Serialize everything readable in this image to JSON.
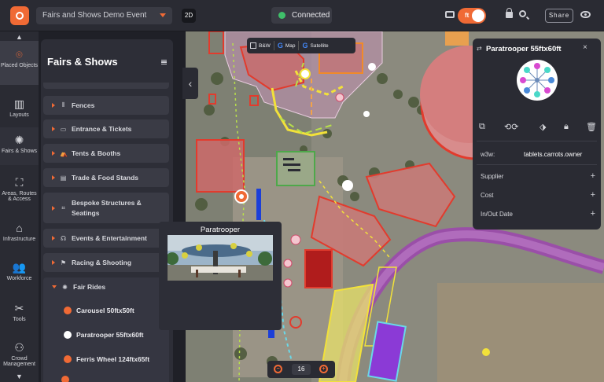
{
  "header": {
    "event_name": "Fairs and Shows Demo Event",
    "view_mode": "2D",
    "status": "Connected",
    "unit": "ft",
    "share_label": "Share"
  },
  "rail": {
    "items": [
      {
        "label": "Placed Objects",
        "icon": "map-pin-icon"
      },
      {
        "label": "Layouts",
        "icon": "columns-icon"
      },
      {
        "label": "Fairs & Shows",
        "icon": "ferris-wheel-icon"
      },
      {
        "label": "Areas, Routes & Access",
        "icon": "area-icon"
      },
      {
        "label": "Infrastructure",
        "icon": "infrastructure-icon"
      },
      {
        "label": "Workforce",
        "icon": "people-icon"
      },
      {
        "label": "Tools",
        "icon": "tools-icon"
      },
      {
        "label": "Crowd Management",
        "icon": "crowd-icon"
      }
    ]
  },
  "panel": {
    "title": "Fairs & Shows",
    "categories": [
      {
        "label": "Fences",
        "icon": "fence-icon"
      },
      {
        "label": "Entrance & Tickets",
        "icon": "ticket-icon"
      },
      {
        "label": "Tents & Booths",
        "icon": "tent-icon"
      },
      {
        "label": "Trade & Food Stands",
        "icon": "stand-icon"
      },
      {
        "label": "Bespoke Structures & Seatings",
        "icon": "structure-icon"
      },
      {
        "label": "Events & Entertainment",
        "icon": "entertainment-icon"
      },
      {
        "label": "Racing & Shooting",
        "icon": "racing-icon"
      },
      {
        "label": "Fair Rides",
        "icon": "ride-icon"
      }
    ],
    "fair_rides": [
      {
        "label": "Carousel 50ftx50ft",
        "color": "#f06a35"
      },
      {
        "label": "Paratrooper 55ftx60ft",
        "color": "#ffffff"
      },
      {
        "label": "Ferris Wheel 124ftx65ft",
        "color": "#f06a35"
      }
    ]
  },
  "map": {
    "type_buttons": [
      "B&W",
      "Map",
      "Satellite"
    ],
    "zoom_level": "16",
    "zoom_out": "−",
    "zoom_in": "+"
  },
  "preview": {
    "title": "Paratrooper"
  },
  "details": {
    "swap_icon": "⇄",
    "title": "Paratrooper 55ftx60ft",
    "close": "×",
    "w3w_label": "w3w:",
    "w3w_value": "tablets.carrots.owner",
    "rows": [
      {
        "label": "Supplier"
      },
      {
        "label": "Cost"
      },
      {
        "label": "In/Out Date"
      }
    ],
    "plus": "+"
  },
  "colors": {
    "accent": "#f06a35",
    "connected": "#3fc06a"
  }
}
